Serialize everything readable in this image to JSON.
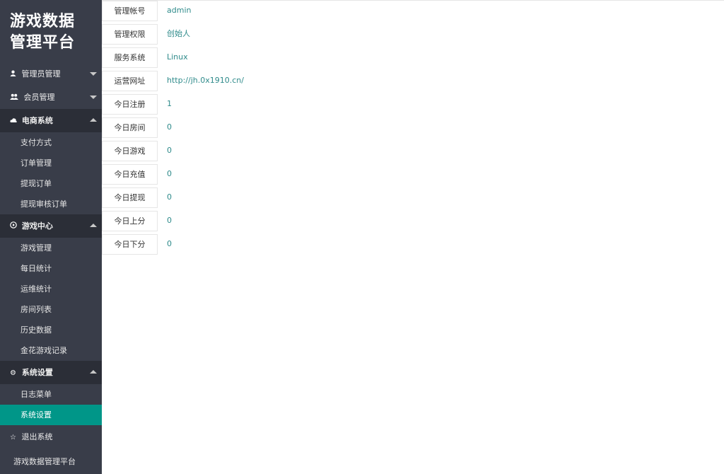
{
  "app": {
    "logo_line1": "游戏数据",
    "logo_line2": "管理平台",
    "footer": "游戏数据管理平台"
  },
  "sidebar": {
    "groups": [
      {
        "label": "管理员管理",
        "icon": "user-icon",
        "state": "collapsed"
      },
      {
        "label": "会员管理",
        "icon": "users-icon",
        "state": "collapsed"
      },
      {
        "label": "电商系统",
        "icon": "cloud-icon",
        "state": "expanded",
        "items": [
          "支付方式",
          "订单管理",
          "提现订单",
          "提现审核订单"
        ]
      },
      {
        "label": "游戏中心",
        "icon": "play-circle-icon",
        "state": "expanded",
        "items": [
          "游戏管理",
          "每日统计",
          "运维统计",
          "房间列表",
          "历史数据",
          "金花游戏记录"
        ]
      },
      {
        "label": "系统设置",
        "icon": "gear-icon",
        "state": "expanded",
        "items": [
          "日志菜单",
          "系统设置"
        ],
        "active_item": "系统设置"
      },
      {
        "label": "退出系统",
        "icon": "star-icon"
      }
    ]
  },
  "info": {
    "rows": [
      {
        "label": "管理帐号",
        "value": "admin"
      },
      {
        "label": "管理权限",
        "value": "创始人"
      },
      {
        "label": "服务系统",
        "value": "Linux"
      },
      {
        "label": "运营网址",
        "value": "http://jh.0x1910.cn/"
      },
      {
        "label": "今日注册",
        "value": "1"
      },
      {
        "label": "今日房间",
        "value": "0"
      },
      {
        "label": "今日游戏",
        "value": "0"
      },
      {
        "label": "今日充值",
        "value": "0"
      },
      {
        "label": "今日提现",
        "value": "0"
      },
      {
        "label": "今日上分",
        "value": "0"
      },
      {
        "label": "今日下分",
        "value": "0"
      }
    ]
  },
  "colors": {
    "sidebar": "#393d49",
    "sidebar_open_group": "#2b2e37",
    "active": "#009688",
    "value_text": "#2f8b8b"
  }
}
